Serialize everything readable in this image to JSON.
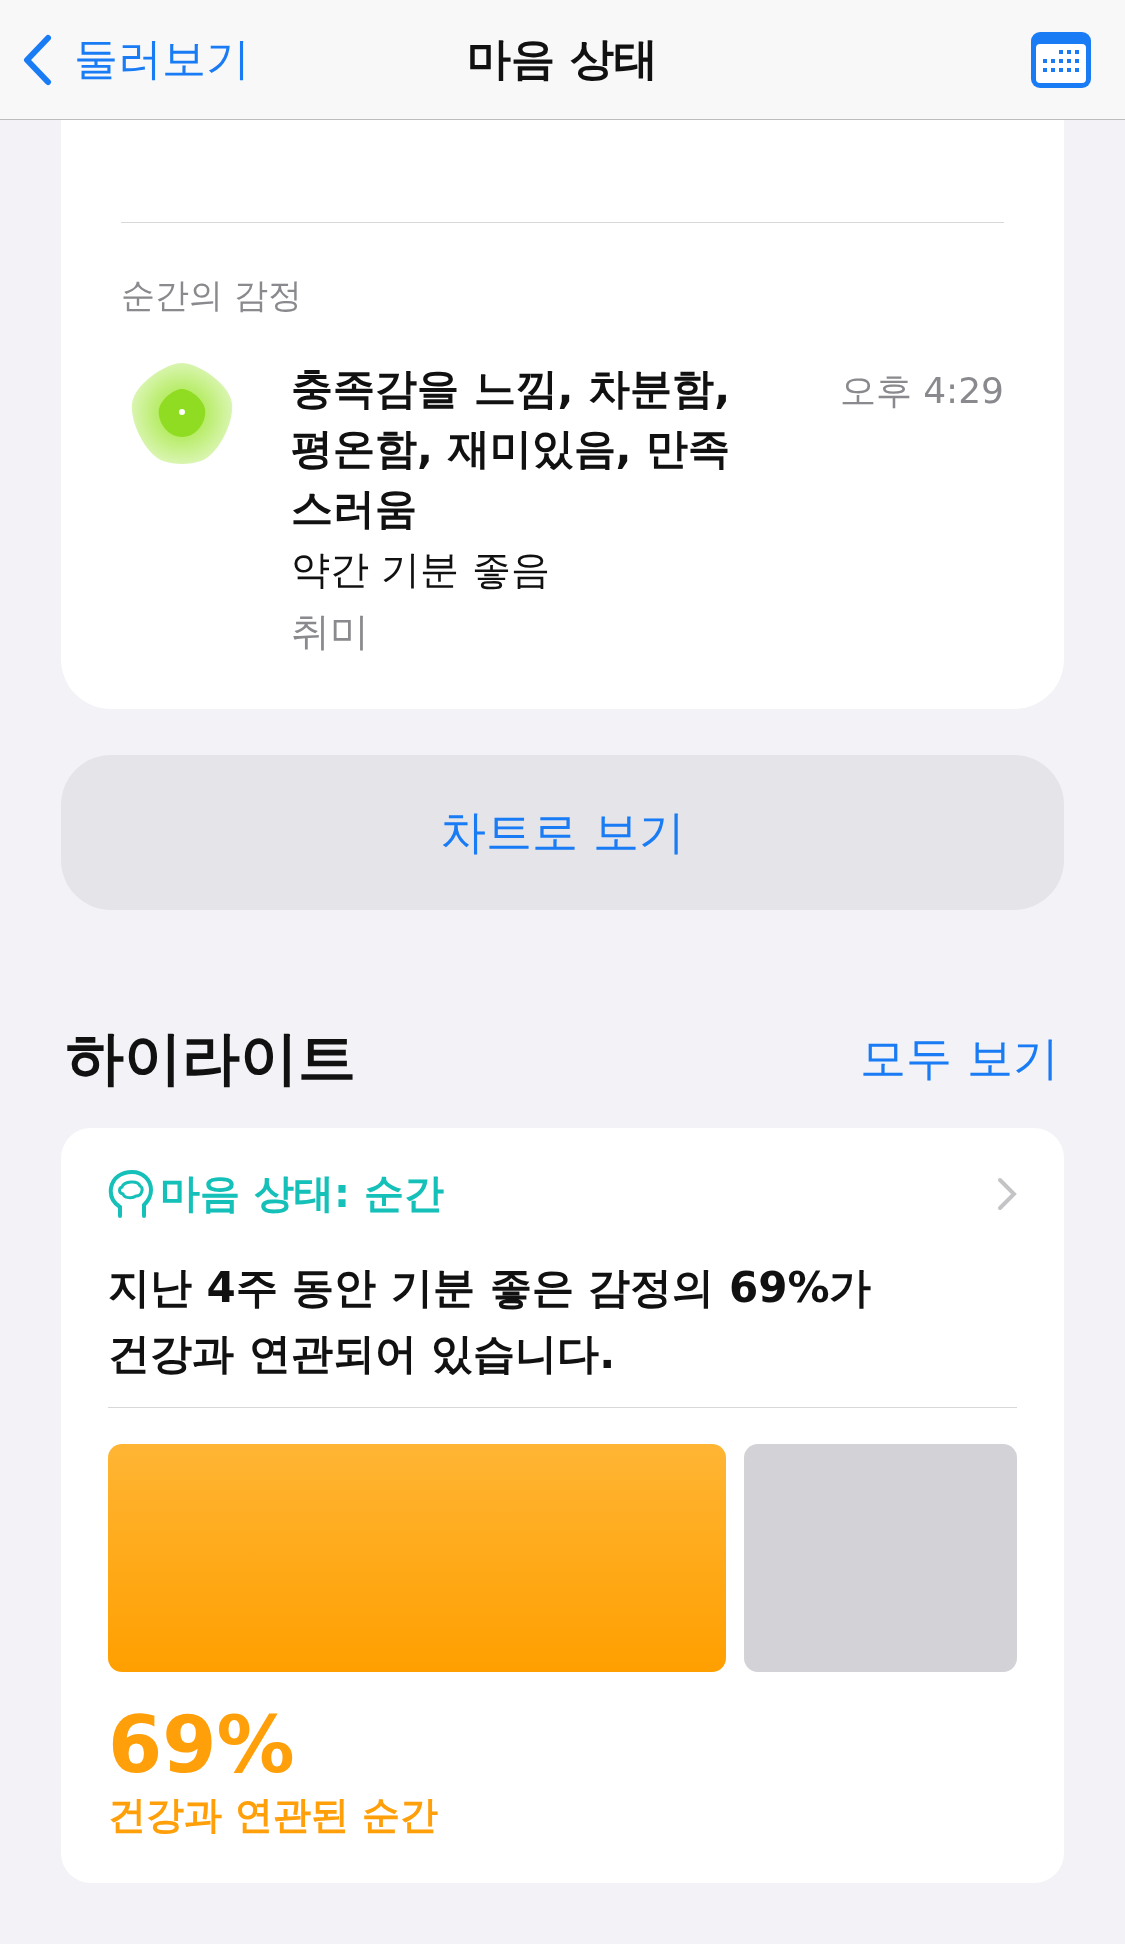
{
  "nav": {
    "back": "둘러보기",
    "title": "마음 상태"
  },
  "moment": {
    "section": "순간의 감정",
    "emotions": "충족감을 느낌, 차분함, 평온함, 재미있음, 만족스러움",
    "mood": "약간 기분 좋음",
    "context": "취미",
    "time": "오후 4:29"
  },
  "chart_button": "차트로 보기",
  "highlights": {
    "title": "하이라이트",
    "see_all": "모두 보기",
    "card": {
      "category": "마음 상태: 순간",
      "summary": "지난 4주 동안 기분 좋은 감정의 69%가 건강과 연관되어 있습니다.",
      "value": "69%",
      "caption": "건강과 연관된 순간"
    }
  }
}
